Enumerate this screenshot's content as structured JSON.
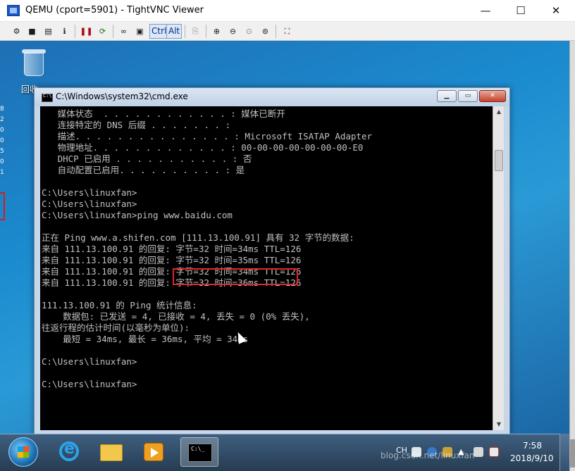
{
  "vnc": {
    "title": "QEMU (cport=5901) - TightVNC Viewer",
    "controls": {
      "minimize": "—",
      "maximize": "☐",
      "close": "✕"
    },
    "toolbar": {
      "icons": [
        "new-connection-icon",
        "save-icon",
        "options-icon",
        "info-icon",
        "pause-icon",
        "refresh-icon",
        "binoculars-icon",
        "ctrl-alt-del-icon",
        "copy-clipboard-icon",
        "zoom-in-icon",
        "zoom-out-icon",
        "zoom-100-icon",
        "zoom-fit-icon",
        "fullscreen-icon"
      ],
      "ctrl_label": "Ctrl",
      "alt_label": "Alt"
    }
  },
  "desktop": {
    "recycle_bin_label": "回收",
    "side_marks": [
      "8",
      "2",
      "0",
      "0",
      "5",
      "0",
      "1"
    ]
  },
  "cmd": {
    "title": "C:\\Windows\\system32\\cmd.exe",
    "controls": {
      "minimize": "▁",
      "maximize": "▭",
      "close": "✕"
    },
    "lines": [
      "   媒体状态  . . . . . . . . . . . . : 媒体已断开",
      "   连接特定的 DNS 后缀 . . . . . . . :",
      "   描述. . . . . . . . . . . . . . . : Microsoft ISATAP Adapter",
      "   物理地址. . . . . . . . . . . . . : 00-00-00-00-00-00-00-E0",
      "   DHCP 已启用 . . . . . . . . . . . : 否",
      "   自动配置已启用. . . . . . . . . . : 是",
      "",
      "C:\\Users\\linuxfan>",
      "C:\\Users\\linuxfan>",
      "C:\\Users\\linuxfan>ping www.baidu.com",
      "",
      "正在 Ping www.a.shifen.com [111.13.100.91] 具有 32 字节的数据:",
      "来自 111.13.100.91 的回复: 字节=32 时间=34ms TTL=126",
      "来自 111.13.100.91 的回复: 字节=32 时间=35ms TTL=126",
      "来自 111.13.100.91 的回复: 字节=32 时间=34ms TTL=126",
      "来自 111.13.100.91 的回复: 字节=32 时间=36ms TTL=126",
      "",
      "111.13.100.91 的 Ping 统计信息:",
      "    数据包: 已发送 = 4, 已接收 = 4, 丢失 = 0 (0% 丢失),",
      "往返行程的估计时间(以毫秒为单位):",
      "    最短 = 34ms, 最长 = 36ms, 平均 = 34ms",
      "",
      "C:\\Users\\linuxfan>",
      "",
      "C:\\Users\\linuxfan>"
    ]
  },
  "taskbar": {
    "apps": [
      "internet-explorer-icon",
      "explorer-folder-icon",
      "media-player-icon",
      "cmd-icon"
    ],
    "tray_lang": "CH",
    "time": "7:58",
    "date": "2018/9/10"
  },
  "watermark": "blog.csdn.net/linuxfan"
}
